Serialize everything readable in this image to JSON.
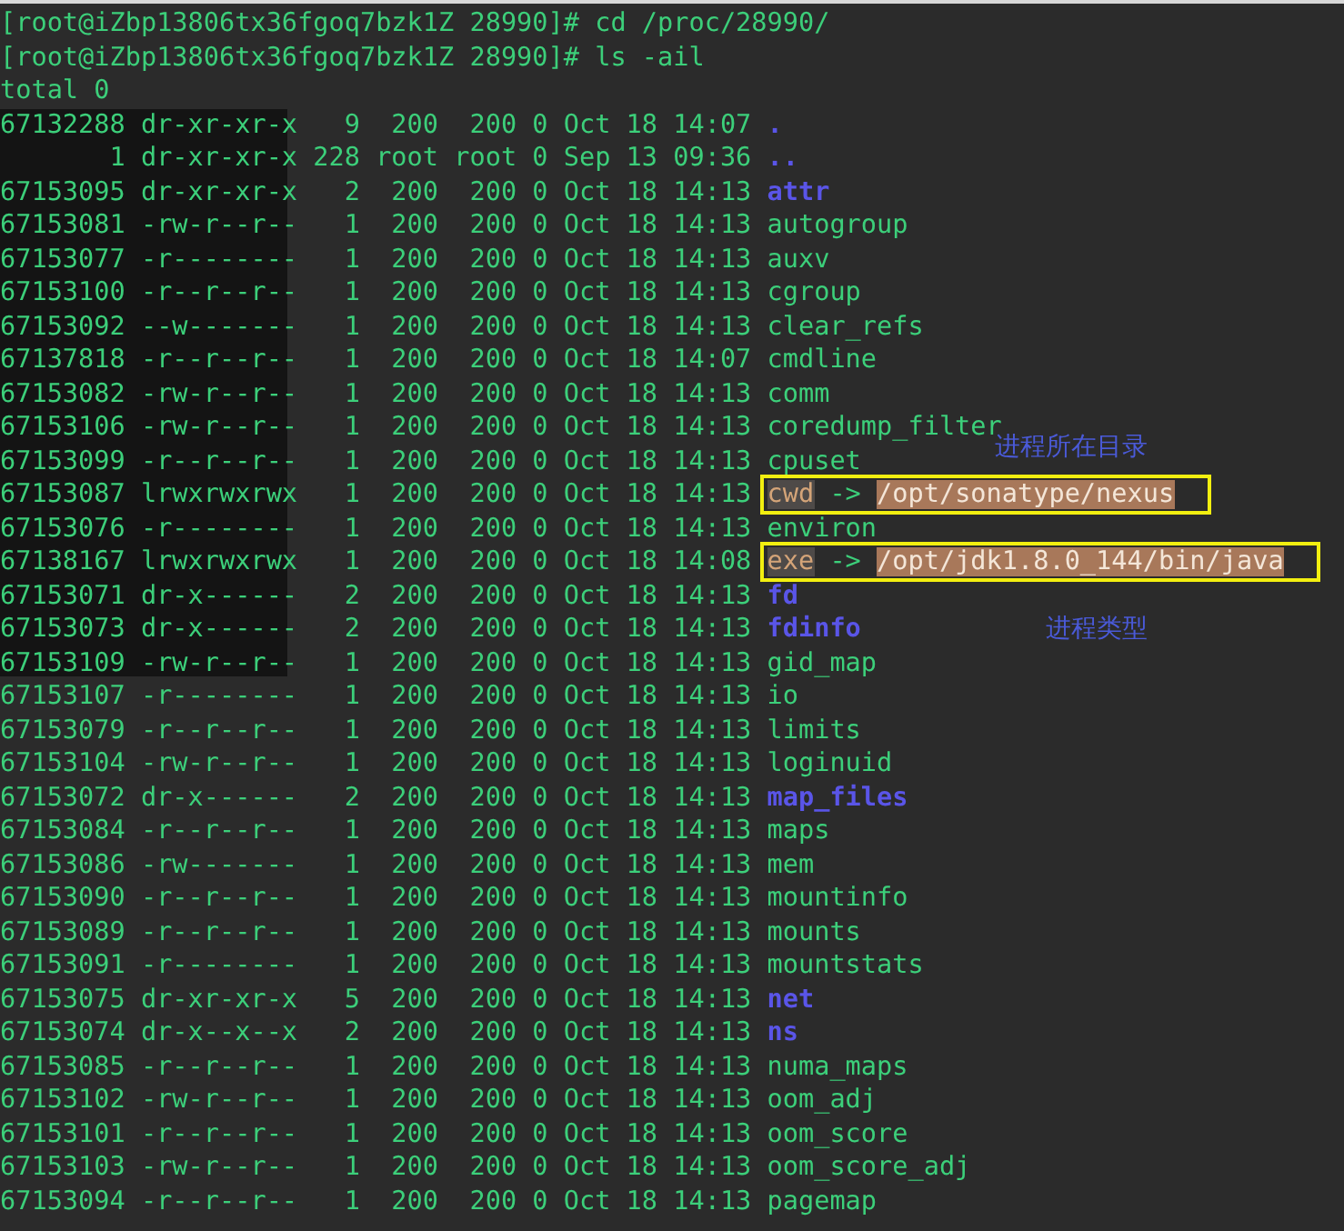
{
  "terminal": {
    "lines": [
      {
        "kind": "prompt",
        "text": "[root@iZbp13806tx36fgoq7bzk1Z 28990]# cd /proc/28990/"
      },
      {
        "kind": "prompt",
        "text": "[root@iZbp13806tx36fgoq7bzk1Z 28990]# ls -ail"
      },
      {
        "kind": "output",
        "text": "total 0"
      },
      {
        "kind": "dir",
        "info": "67132288 dr-xr-xr-x   9  200  200 0 Oct 18 14:07",
        "name": "."
      },
      {
        "kind": "dir",
        "info": "       1 dr-xr-xr-x 228 root root 0 Sep 13 09:36",
        "name": ".."
      },
      {
        "kind": "dir",
        "info": "67153095 dr-xr-xr-x   2  200  200 0 Oct 18 14:13",
        "name": "attr"
      },
      {
        "kind": "file",
        "info": "67153081 -rw-r--r--   1  200  200 0 Oct 18 14:13",
        "name": "autogroup"
      },
      {
        "kind": "file",
        "info": "67153077 -r--------   1  200  200 0 Oct 18 14:13",
        "name": "auxv"
      },
      {
        "kind": "file",
        "info": "67153100 -r--r--r--   1  200  200 0 Oct 18 14:13",
        "name": "cgroup"
      },
      {
        "kind": "file",
        "info": "67153092 --w-------   1  200  200 0 Oct 18 14:13",
        "name": "clear_refs"
      },
      {
        "kind": "file",
        "info": "67137818 -r--r--r--   1  200  200 0 Oct 18 14:07",
        "name": "cmdline"
      },
      {
        "kind": "file",
        "info": "67153082 -rw-r--r--   1  200  200 0 Oct 18 14:13",
        "name": "comm"
      },
      {
        "kind": "file",
        "info": "67153106 -rw-r--r--   1  200  200 0 Oct 18 14:13",
        "name": "coredump_filter"
      },
      {
        "kind": "file",
        "info": "67153099 -r--r--r--   1  200  200 0 Oct 18 14:13",
        "name": "cpuset",
        "note": "进程所在目录"
      },
      {
        "kind": "link",
        "info": "67153087 lrwxrwxrwx   1  200  200 0 Oct 18 14:13",
        "name": "cwd",
        "arrow": "->",
        "target": "/opt/sonatype/nexus"
      },
      {
        "kind": "file",
        "info": "67153076 -r--------   1  200  200 0 Oct 18 14:13",
        "name": "environ"
      },
      {
        "kind": "link",
        "info": "67138167 lrwxrwxrwx   1  200  200 0 Oct 18 14:08",
        "name": "exe",
        "arrow": "->",
        "target": "/opt/jdk1.8.0_144/bin/java"
      },
      {
        "kind": "dir",
        "info": "67153071 dr-x------   2  200  200 0 Oct 18 14:13",
        "name": "fd"
      },
      {
        "kind": "dir",
        "info": "67153073 dr-x------   2  200  200 0 Oct 18 14:13",
        "name": "fdinfo",
        "note": "进程类型"
      },
      {
        "kind": "file",
        "info": "67153109 -rw-r--r--   1  200  200 0 Oct 18 14:13",
        "name": "gid_map"
      },
      {
        "kind": "file",
        "info": "67153107 -r--------   1  200  200 0 Oct 18 14:13",
        "name": "io"
      },
      {
        "kind": "file",
        "info": "67153079 -r--r--r--   1  200  200 0 Oct 18 14:13",
        "name": "limits"
      },
      {
        "kind": "file",
        "info": "67153104 -rw-r--r--   1  200  200 0 Oct 18 14:13",
        "name": "loginuid"
      },
      {
        "kind": "dir",
        "info": "67153072 dr-x------   2  200  200 0 Oct 18 14:13",
        "name": "map_files"
      },
      {
        "kind": "file",
        "info": "67153084 -r--r--r--   1  200  200 0 Oct 18 14:13",
        "name": "maps"
      },
      {
        "kind": "file",
        "info": "67153086 -rw-------   1  200  200 0 Oct 18 14:13",
        "name": "mem"
      },
      {
        "kind": "file",
        "info": "67153090 -r--r--r--   1  200  200 0 Oct 18 14:13",
        "name": "mountinfo"
      },
      {
        "kind": "file",
        "info": "67153089 -r--r--r--   1  200  200 0 Oct 18 14:13",
        "name": "mounts"
      },
      {
        "kind": "file",
        "info": "67153091 -r--------   1  200  200 0 Oct 18 14:13",
        "name": "mountstats"
      },
      {
        "kind": "dir",
        "info": "67153075 dr-xr-xr-x   5  200  200 0 Oct 18 14:13",
        "name": "net"
      },
      {
        "kind": "dir",
        "info": "67153074 dr-x--x--x   2  200  200 0 Oct 18 14:13",
        "name": "ns"
      },
      {
        "kind": "file",
        "info": "67153085 -r--r--r--   1  200  200 0 Oct 18 14:13",
        "name": "numa_maps"
      },
      {
        "kind": "file",
        "info": "67153102 -rw-r--r--   1  200  200 0 Oct 18 14:13",
        "name": "oom_adj"
      },
      {
        "kind": "file",
        "info": "67153101 -r--r--r--   1  200  200 0 Oct 18 14:13",
        "name": "oom_score"
      },
      {
        "kind": "file",
        "info": "67153103 -rw-r--r--   1  200  200 0 Oct 18 14:13",
        "name": "oom_score_adj"
      },
      {
        "kind": "file",
        "info": "67153094 -r--r--r--   1  200  200 0 Oct 18 14:13",
        "name": "pagemap"
      }
    ]
  }
}
